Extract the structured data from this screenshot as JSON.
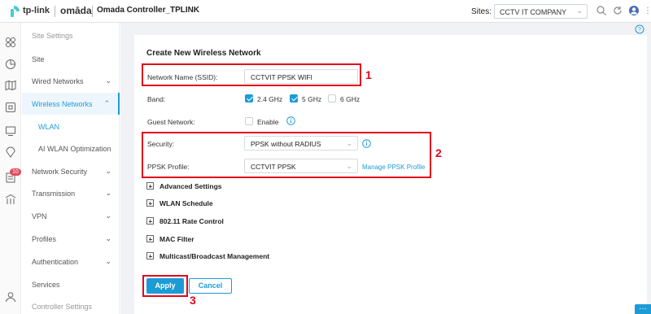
{
  "topbar": {
    "logo_text": "tp-link",
    "omada_text": "omāda",
    "app_title": "Omada Controller_TPLINK",
    "sites_label": "Sites:",
    "sites_value": "CCTV IT COMPANY"
  },
  "rail": {
    "badge": "10"
  },
  "sidebar": {
    "items": [
      {
        "label": "Site Settings"
      },
      {
        "label": "Site"
      },
      {
        "label": "Wired Networks"
      },
      {
        "label": "Wireless Networks"
      },
      {
        "label": "WLAN"
      },
      {
        "label": "AI WLAN Optimization"
      },
      {
        "label": "Network Security"
      },
      {
        "label": "Transmission"
      },
      {
        "label": "VPN"
      },
      {
        "label": "Profiles"
      },
      {
        "label": "Authentication"
      },
      {
        "label": "Services"
      },
      {
        "label": "Controller Settings"
      }
    ]
  },
  "form": {
    "title": "Create New Wireless Network",
    "ssid_label": "Network Name (SSID):",
    "ssid_value": "CCTVIT PPSK WIFI",
    "band_label": "Band:",
    "band_options": [
      {
        "label": "2.4 GHz",
        "checked": true
      },
      {
        "label": "5 GHz",
        "checked": true
      },
      {
        "label": "6 GHz",
        "checked": false
      }
    ],
    "guest_label": "Guest Network:",
    "guest_option": "Enable",
    "security_label": "Security:",
    "security_value": "PPSK without RADIUS",
    "ppsk_label": "PPSK Profile:",
    "ppsk_value": "CCTVIT PPSK",
    "manage_link": "Manage PPSK Profile",
    "sections": [
      "Advanced Settings",
      "WLAN Schedule",
      "802.11 Rate Control",
      "MAC Filter",
      "Multicast/Broadcast Management"
    ],
    "apply_label": "Apply",
    "cancel_label": "Cancel"
  },
  "annotations": [
    "1",
    "2",
    "3"
  ],
  "colors": {
    "accent": "#1d9bd7",
    "highlight": "#e2061b",
    "badge": "#e24b5c"
  }
}
